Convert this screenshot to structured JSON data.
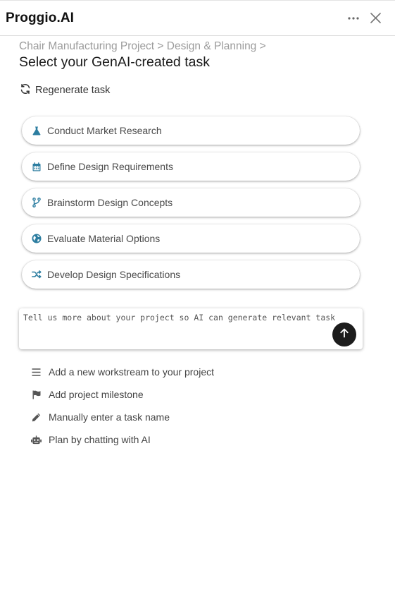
{
  "header": {
    "brand": "Proggio.AI",
    "more_icon": "more-horizontal-icon",
    "close_icon": "close-icon"
  },
  "breadcrumb": "Chair Manufacturing Project > Design & Planning >",
  "title": "Select your GenAI-created task",
  "regenerate": {
    "label": "Regenerate task",
    "icon": "refresh-icon"
  },
  "tasks": [
    {
      "label": "Conduct Market Research",
      "icon": "flask-icon"
    },
    {
      "label": "Define Design Requirements",
      "icon": "calendar-icon"
    },
    {
      "label": "Brainstorm Design Concepts",
      "icon": "branch-icon"
    },
    {
      "label": "Evaluate Material Options",
      "icon": "globe-icon"
    },
    {
      "label": "Develop Design Specifications",
      "icon": "shuffle-icon"
    }
  ],
  "prompt": {
    "placeholder": "Tell us more about your project so AI can generate relevant task",
    "send_icon": "arrow-up-icon"
  },
  "options": [
    {
      "label": "Add a new workstream to your project",
      "icon": "list-icon"
    },
    {
      "label": "Add project milestone",
      "icon": "flag-icon"
    },
    {
      "label": "Manually enter a task name",
      "icon": "pencil-icon"
    },
    {
      "label": "Plan by chatting with AI",
      "icon": "robot-icon"
    }
  ],
  "colors": {
    "task_icon": "#2c7da0",
    "send_button": "#1c1c1c",
    "breadcrumb": "#9b9b9b"
  }
}
